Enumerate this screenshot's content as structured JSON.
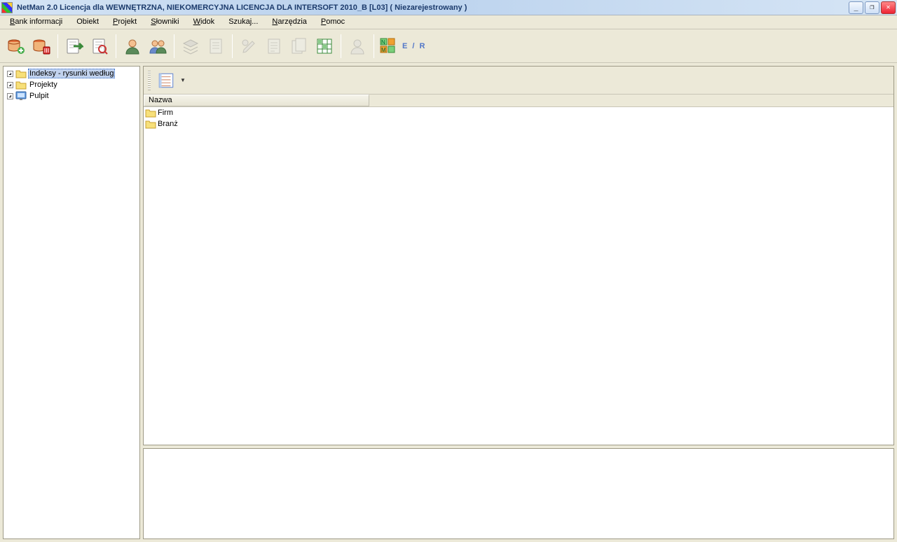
{
  "window": {
    "title": "NetMan 2.0 Licencja dla WEWNĘTRZNA, NIEKOMERCYJNA LICENCJA DLA INTERSOFT 2010_B [L03] ( Niezarejestrowany )"
  },
  "menu": {
    "bank_informacji": "Bank informacji",
    "obiekt": "Obiekt",
    "projekt": "Projekt",
    "slowniki": "Słowniki",
    "widok": "Widok",
    "szukaj": "Szukaj...",
    "narzedzia": "Narzędzia",
    "pomoc": "Pomoc"
  },
  "toolbar": {
    "er_label": "E / R"
  },
  "tree": {
    "items": [
      {
        "label": "Indeksy - rysunki według",
        "icon": "folder",
        "selected": true
      },
      {
        "label": "Projekty",
        "icon": "folder",
        "selected": false
      },
      {
        "label": "Pulpit",
        "icon": "desktop",
        "selected": false
      }
    ]
  },
  "list": {
    "column_header": "Nazwa",
    "rows": [
      {
        "label": "Firm"
      },
      {
        "label": "Branż"
      }
    ]
  }
}
